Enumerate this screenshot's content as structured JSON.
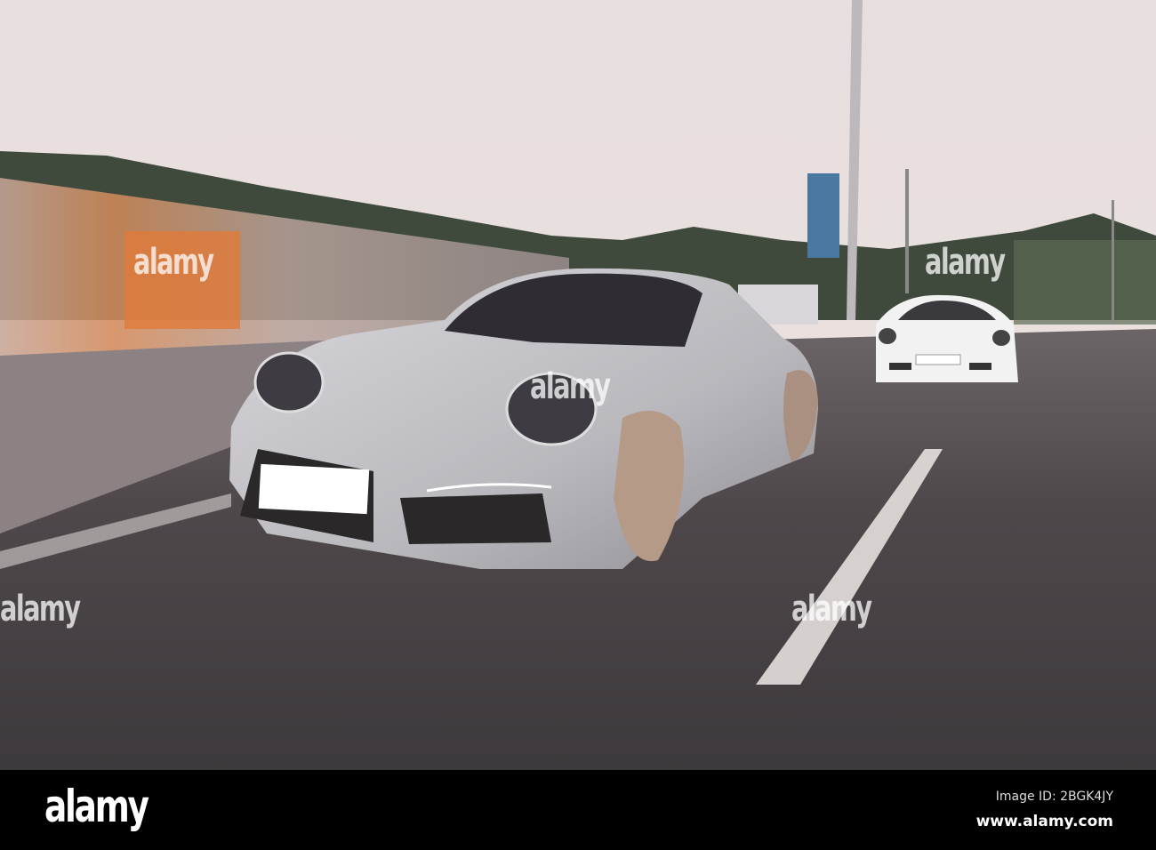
{
  "watermark": {
    "text": "alamy"
  },
  "footer": {
    "logo": "alamy",
    "image_id": "Image ID: 2BGK4JY",
    "site": "www.alamy.com"
  },
  "colors": {
    "sky": "#e9e1e0",
    "road": "#4b4649",
    "car_silver": "#c9c8cc",
    "car_white": "#f2f2f2"
  }
}
